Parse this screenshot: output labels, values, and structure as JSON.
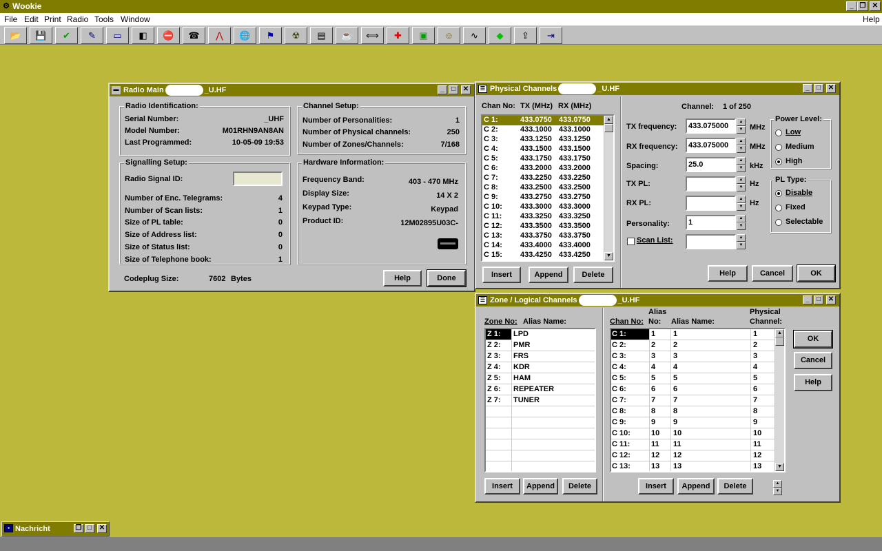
{
  "app": {
    "title": "Wookie",
    "title_controls": [
      "_",
      "❐",
      "✕"
    ]
  },
  "menu": [
    "File",
    "Edit",
    "Print",
    "Radio",
    "Tools",
    "Window"
  ],
  "menu_help": "Help",
  "toolbar": [
    {
      "icon": "open-folder-icon",
      "glyph": "📂",
      "color": "#806000"
    },
    {
      "icon": "save-disk-icon",
      "glyph": "💾",
      "color": "#0000a0"
    },
    {
      "icon": "checkmark-icon",
      "glyph": "✔",
      "color": "#00a000"
    },
    {
      "icon": "edit-document-icon",
      "glyph": "✎",
      "color": "#000080"
    },
    {
      "icon": "card-icon",
      "glyph": "▭",
      "color": "#000080"
    },
    {
      "icon": "read-radio-icon",
      "glyph": "◧",
      "color": "#000"
    },
    {
      "icon": "stop-icon",
      "glyph": "⛔",
      "color": "#c00000"
    },
    {
      "icon": "telephone-icon",
      "glyph": "☎",
      "color": "#000"
    },
    {
      "icon": "antenna-icon",
      "glyph": "⋀",
      "color": "#c00000"
    },
    {
      "icon": "globe-icon",
      "glyph": "🌐",
      "color": "#0000a0"
    },
    {
      "icon": "flags-icon",
      "glyph": "⚑",
      "color": "#0000c0"
    },
    {
      "icon": "bug-icon",
      "glyph": "☢",
      "color": "#404000"
    },
    {
      "icon": "document-icon",
      "glyph": "▤",
      "color": "#000"
    },
    {
      "icon": "cup-icon",
      "glyph": "☕",
      "color": "#000"
    },
    {
      "icon": "arrows-icon",
      "glyph": "⟺",
      "color": "#000"
    },
    {
      "icon": "plus-icon",
      "glyph": "✚",
      "color": "#e00000"
    },
    {
      "icon": "display-icon",
      "glyph": "▣",
      "color": "#00a000"
    },
    {
      "icon": "smiley-icon",
      "glyph": "☺",
      "color": "#806000"
    },
    {
      "icon": "wave-icon",
      "glyph": "∿",
      "color": "#000"
    },
    {
      "icon": "diamond-icon",
      "glyph": "◆",
      "color": "#00c000"
    },
    {
      "icon": "upload-icon",
      "glyph": "⇪",
      "color": "#000"
    },
    {
      "icon": "exit-door-icon",
      "glyph": "⇥",
      "color": "#0000a0"
    }
  ],
  "radio_main": {
    "title_pre": "Radio Main",
    "title_post": "_U.HF",
    "radio_id": {
      "label": "Radio Identification:",
      "serial_label": "Serial Number:",
      "serial": "_UHF",
      "model_label": "Model Number:",
      "model": "M01RHN9AN8AN",
      "prog_label": "Last Programmed:",
      "prog": "10-05-09 19:53"
    },
    "channel_setup": {
      "label": "Channel Setup:",
      "pers_label": "Number of Personalities:",
      "pers": "1",
      "phys_label": "Number of Physical channels:",
      "phys": "250",
      "zones_label": "Number of Zones/Channels:",
      "zones": "7/168"
    },
    "signalling": {
      "label": "Signalling Setup:",
      "signal_id_label": "Radio Signal ID:",
      "signal_id": "",
      "rows": [
        {
          "k": "Number of Enc. Telegrams:",
          "v": "4"
        },
        {
          "k": "Number of Scan lists:",
          "v": "1"
        },
        {
          "k": "Size of PL table:",
          "v": "0"
        },
        {
          "k": "Size of Address list:",
          "v": "0"
        },
        {
          "k": "Size of Status list:",
          "v": "0"
        },
        {
          "k": "Size of Telephone book:",
          "v": "1"
        }
      ]
    },
    "hardware": {
      "label": "Hardware Information:",
      "rows": [
        {
          "k": "Frequency Band:",
          "v": "403 - 470 MHz"
        },
        {
          "k": "Display Size:",
          "v": "14 X 2"
        },
        {
          "k": "Keypad Type:",
          "v": "Keypad"
        },
        {
          "k": "Product ID:",
          "v": "12M02895U03C-"
        }
      ]
    },
    "codeplug_label": "Codeplug Size:",
    "codeplug_value": "7602",
    "codeplug_unit": "Bytes",
    "help": "Help",
    "done": "Done"
  },
  "physical": {
    "title_pre": "Physical Channels",
    "title_post": "_U.HF",
    "cols": [
      "Chan No:",
      "TX (MHz)",
      "RX (MHz)"
    ],
    "rows": [
      [
        "C 1:",
        "433.0750",
        "433.0750"
      ],
      [
        "C 2:",
        "433.1000",
        "433.1000"
      ],
      [
        "C 3:",
        "433.1250",
        "433.1250"
      ],
      [
        "C 4:",
        "433.1500",
        "433.1500"
      ],
      [
        "C 5:",
        "433.1750",
        "433.1750"
      ],
      [
        "C 6:",
        "433.2000",
        "433.2000"
      ],
      [
        "C 7:",
        "433.2250",
        "433.2250"
      ],
      [
        "C 8:",
        "433.2500",
        "433.2500"
      ],
      [
        "C 9:",
        "433.2750",
        "433.2750"
      ],
      [
        "C 10:",
        "433.3000",
        "433.3000"
      ],
      [
        "C 11:",
        "433.3250",
        "433.3250"
      ],
      [
        "C 12:",
        "433.3500",
        "433.3500"
      ],
      [
        "C 13:",
        "433.3750",
        "433.3750"
      ],
      [
        "C 14:",
        "433.4000",
        "433.4000"
      ],
      [
        "C 15:",
        "433.4250",
        "433.4250"
      ]
    ],
    "channel_label": "Channel:",
    "channel_value": "1 of 250",
    "tx_label": "TX frequency:",
    "tx": "433.075000",
    "tx_unit": "MHz",
    "rx_label": "RX frequency:",
    "rx": "433.075000",
    "rx_unit": "MHz",
    "spacing_label": "Spacing:",
    "spacing": "25.0",
    "spacing_unit": "kHz",
    "txpl_label": "TX PL:",
    "txpl": "",
    "txpl_unit": "Hz",
    "rxpl_label": "RX PL:",
    "rxpl": "",
    "rxpl_unit": "Hz",
    "pers_label": "Personality:",
    "pers": "1",
    "scan_label": "Scan List:",
    "scan": "",
    "power": {
      "label": "Power Level:",
      "options": [
        "Low",
        "Medium",
        "High"
      ],
      "selected": "High"
    },
    "pl_type": {
      "label": "PL Type:",
      "options": [
        "Disable",
        "Fixed",
        "Selectable"
      ],
      "selected": "Disable"
    },
    "insert": "Insert",
    "append": "Append",
    "delete": "Delete",
    "help": "Help",
    "cancel": "Cancel",
    "ok": "OK"
  },
  "zone": {
    "title_pre": "Zone / Logical Channels",
    "title_post": "_U.HF",
    "zone_cols": [
      "Zone No:",
      "Alias Name:"
    ],
    "zones": [
      [
        "Z 1:",
        "LPD"
      ],
      [
        "Z 2:",
        "PMR"
      ],
      [
        "Z 3:",
        "FRS"
      ],
      [
        "Z 4:",
        "KDR"
      ],
      [
        "Z 5:",
        "HAM"
      ],
      [
        "Z 6:",
        "REPEATER"
      ],
      [
        "Z 7:",
        "TUNER"
      ]
    ],
    "ch_cols": {
      "chan": "Chan No:",
      "alias_top": "Alias",
      "alias_no": "No:",
      "alias_name": "Alias Name:",
      "phys_top": "Physical",
      "phys": "Channel:"
    },
    "channels": [
      [
        "C 1:",
        "1",
        "1",
        "1"
      ],
      [
        "C 2:",
        "2",
        "2",
        "2"
      ],
      [
        "C 3:",
        "3",
        "3",
        "3"
      ],
      [
        "C 4:",
        "4",
        "4",
        "4"
      ],
      [
        "C 5:",
        "5",
        "5",
        "5"
      ],
      [
        "C 6:",
        "6",
        "6",
        "6"
      ],
      [
        "C 7:",
        "7",
        "7",
        "7"
      ],
      [
        "C 8:",
        "8",
        "8",
        "8"
      ],
      [
        "C 9:",
        "9",
        "9",
        "9"
      ],
      [
        "C 10:",
        "10",
        "10",
        "10"
      ],
      [
        "C 11:",
        "11",
        "11",
        "11"
      ],
      [
        "C 12:",
        "12",
        "12",
        "12"
      ],
      [
        "C 13:",
        "13",
        "13",
        "13"
      ]
    ],
    "insert": "Insert",
    "append": "Append",
    "delete": "Delete",
    "ok": "OK",
    "cancel": "Cancel",
    "help": "Help"
  },
  "nachricht": {
    "title": "Nachricht"
  }
}
